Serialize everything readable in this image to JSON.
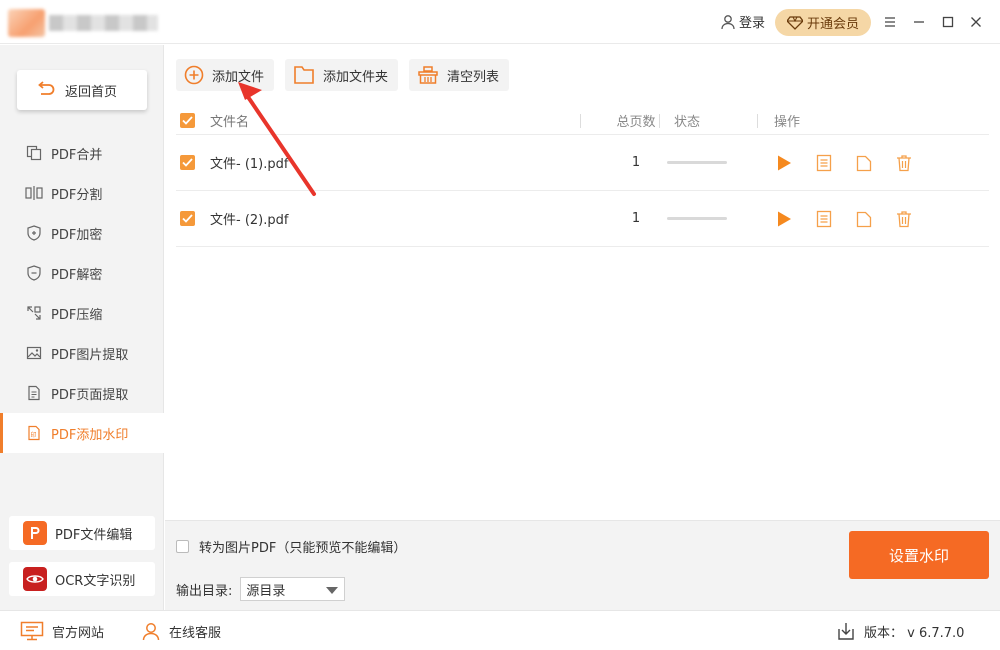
{
  "header": {
    "login_label": "登录",
    "vip_label": "开通会员"
  },
  "sidebar": {
    "back_label": "返回首页",
    "items": [
      {
        "label": "PDF合并",
        "icon": "merge-icon"
      },
      {
        "label": "PDF分割",
        "icon": "split-icon"
      },
      {
        "label": "PDF加密",
        "icon": "lock-shield-icon"
      },
      {
        "label": "PDF解密",
        "icon": "unlock-shield-icon"
      },
      {
        "label": "PDF压缩",
        "icon": "compress-icon"
      },
      {
        "label": "PDF图片提取",
        "icon": "image-icon"
      },
      {
        "label": "PDF页面提取",
        "icon": "page-icon"
      },
      {
        "label": "PDF添加水印",
        "icon": "watermark-icon",
        "active": true
      }
    ],
    "tools": [
      {
        "label": "PDF文件编辑",
        "icon": "pdf-editor-icon"
      },
      {
        "label": "OCR文字识别",
        "icon": "ocr-eye-icon"
      }
    ]
  },
  "toolbar": {
    "add_file": "添加文件",
    "add_folder": "添加文件夹",
    "clear_list": "清空列表"
  },
  "table": {
    "headers": {
      "name": "文件名",
      "pages": "总页数",
      "status": "状态",
      "op": "操作"
    },
    "rows": [
      {
        "name": "文件- (1).pdf",
        "pages": "1",
        "checked": true,
        "progress": 0
      },
      {
        "name": "文件- (2).pdf",
        "pages": "1",
        "checked": true,
        "progress": 0
      }
    ]
  },
  "bottom": {
    "convert_label": "转为图片PDF（只能预览不能编辑）",
    "output_label": "输出目录:",
    "output_value": "源目录",
    "primary_button": "设置水印"
  },
  "statusbar": {
    "website": "官方网站",
    "support": "在线客服",
    "version": "版本： v 6.7.7.0"
  },
  "colors": {
    "accent": "#f07e2b",
    "primary_button": "#f56a24",
    "vip_bg": "#f5d7a6",
    "arrow": "#e8352b"
  }
}
